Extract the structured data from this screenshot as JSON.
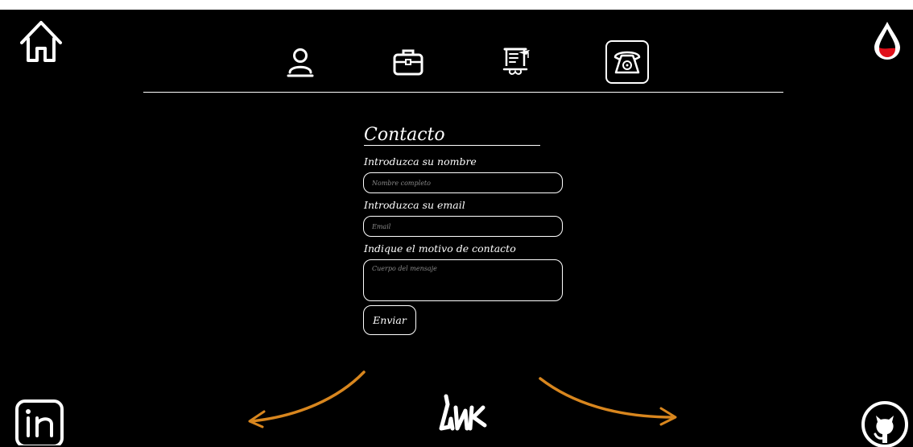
{
  "form": {
    "title": "Contacto",
    "name_label": "Introduzca su nombre",
    "name_placeholder": "Nombre completo",
    "email_label": "Introduzca su email",
    "email_placeholder": "Email",
    "message_label": "Indique el motivo de contacto",
    "message_placeholder": "Cuerpo del mensaje",
    "submit_label": "Enviar"
  },
  "nav": {
    "items": [
      {
        "icon": "user-icon",
        "active": false
      },
      {
        "icon": "briefcase-icon",
        "active": false
      },
      {
        "icon": "graduation-icon",
        "active": false
      },
      {
        "icon": "telephone-icon",
        "active": true
      }
    ]
  },
  "icons": {
    "home": "home-icon",
    "theme": "drop-icon",
    "linkedin": "linkedin-icon",
    "github": "github-icon",
    "logo": "logo-icon"
  },
  "colors": {
    "background": "#000000",
    "foreground": "#ffffff",
    "accent_red": "#e0101a",
    "arrow_orange": "#d8861e"
  }
}
